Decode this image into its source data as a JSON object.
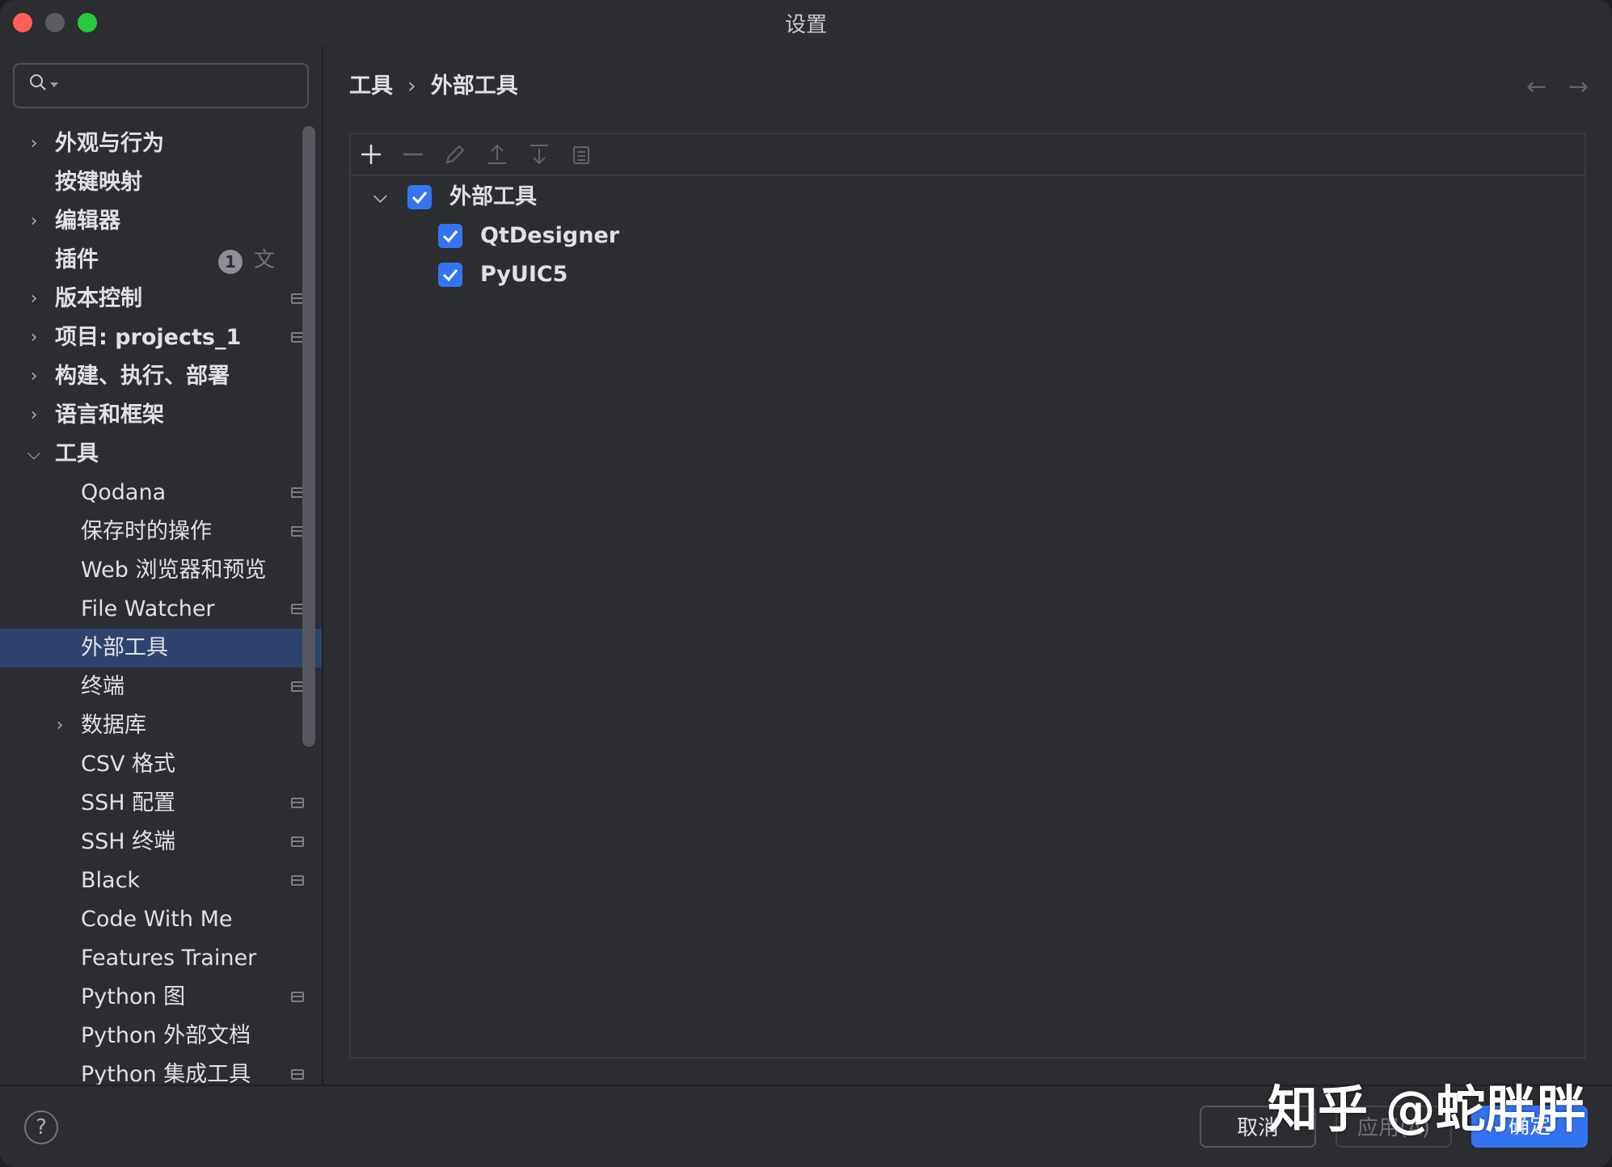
{
  "window": {
    "title": "设置"
  },
  "search": {
    "placeholder": ""
  },
  "sidebar": {
    "items": [
      {
        "label": "外观与行为",
        "level": 0,
        "chevron": "right"
      },
      {
        "label": "按键映射",
        "level": 0,
        "chevron": "none"
      },
      {
        "label": "编辑器",
        "level": 0,
        "chevron": "right"
      },
      {
        "label": "插件",
        "level": 0,
        "chevron": "none",
        "badge": "1",
        "translate_icon": true
      },
      {
        "label": "版本控制",
        "level": 0,
        "chevron": "right",
        "project_icon": true
      },
      {
        "label": "项目: projects_1",
        "level": 0,
        "chevron": "right",
        "project_icon": true
      },
      {
        "label": "构建、执行、部署",
        "level": 0,
        "chevron": "right"
      },
      {
        "label": "语言和框架",
        "level": 0,
        "chevron": "right"
      },
      {
        "label": "工具",
        "level": 0,
        "chevron": "down"
      },
      {
        "label": "Qodana",
        "level": 1,
        "project_icon": true
      },
      {
        "label": "保存时的操作",
        "level": 1,
        "project_icon": true
      },
      {
        "label": "Web 浏览器和预览",
        "level": 1
      },
      {
        "label": "File Watcher",
        "level": 1,
        "project_icon": true
      },
      {
        "label": "外部工具",
        "level": 1,
        "selected": true
      },
      {
        "label": "终端",
        "level": 1,
        "project_icon": true
      },
      {
        "label": "数据库",
        "level": 1,
        "chevron": "right"
      },
      {
        "label": "CSV 格式",
        "level": 1
      },
      {
        "label": "SSH 配置",
        "level": 1,
        "project_icon": true
      },
      {
        "label": "SSH 终端",
        "level": 1,
        "project_icon": true
      },
      {
        "label": "Black",
        "level": 1,
        "project_icon": true
      },
      {
        "label": "Code With Me",
        "level": 1
      },
      {
        "label": "Features Trainer",
        "level": 1
      },
      {
        "label": "Python 图",
        "level": 1,
        "project_icon": true
      },
      {
        "label": "Python 外部文档",
        "level": 1
      },
      {
        "label": "Python 集成工具",
        "level": 1,
        "project_icon": true
      }
    ]
  },
  "breadcrumb": {
    "parent": "工具",
    "sep": "›",
    "current": "外部工具"
  },
  "toolbar": {
    "buttons": [
      "add-icon",
      "remove-icon",
      "edit-icon",
      "move-up-icon",
      "move-down-icon",
      "copy-icon"
    ]
  },
  "tools_tree": {
    "group": {
      "label": "外部工具",
      "checked": true
    },
    "children": [
      {
        "label": "QtDesigner",
        "checked": true
      },
      {
        "label": "PyUIC5",
        "checked": true
      }
    ]
  },
  "footer": {
    "help": "?",
    "cancel": "取消",
    "apply": "应用(A)",
    "ok": "确定"
  },
  "watermark": "知乎 @蛇胖胖",
  "colors": {
    "accent": "#3574f0",
    "selected_row": "#2e436e",
    "background": "#2b2d30"
  }
}
